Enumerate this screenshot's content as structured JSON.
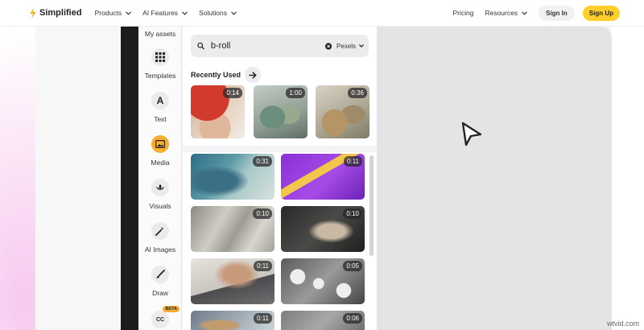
{
  "nav": {
    "brand": "Simplified",
    "menu": [
      {
        "label": "Products"
      },
      {
        "label": "AI Features"
      },
      {
        "label": "Solutions"
      }
    ],
    "pricing": "Pricing",
    "resources": "Resources",
    "sign_in": "Sign In",
    "sign_up": "Sign Up"
  },
  "sidebar": {
    "items": [
      {
        "label": "My assets",
        "icon": "folder-icon"
      },
      {
        "label": "Templates",
        "icon": "grid-icon"
      },
      {
        "label": "Text",
        "icon": "text-icon",
        "glyph": "A"
      },
      {
        "label": "Media",
        "icon": "image-icon",
        "active": true
      },
      {
        "label": "Visuals",
        "icon": "shapes-icon"
      },
      {
        "label": "AI Images",
        "icon": "magic-wand-icon"
      },
      {
        "label": "Draw",
        "icon": "brush-icon"
      },
      {
        "label": "",
        "icon": "captions-icon",
        "glyph": "CC",
        "badge": "BETA"
      }
    ]
  },
  "panel": {
    "search": {
      "value": "b-roll",
      "source": "Pexels"
    },
    "recent_title": "Recently Used",
    "recent": [
      {
        "duration": "0:14"
      },
      {
        "duration": "1:00"
      },
      {
        "duration": "0:36"
      }
    ],
    "grid": [
      {
        "duration": "0:31"
      },
      {
        "duration": "0:11"
      },
      {
        "duration": "0:10"
      },
      {
        "duration": "0:10"
      },
      {
        "duration": "0:11"
      },
      {
        "duration": "0:05"
      },
      {
        "duration": "0:11"
      },
      {
        "duration": "0:06"
      }
    ]
  },
  "colors": {
    "accent": "#f7ad2e",
    "signup": "#ffce2b",
    "canvas": "#e4e4e6"
  },
  "watermark": "wtvid.com"
}
